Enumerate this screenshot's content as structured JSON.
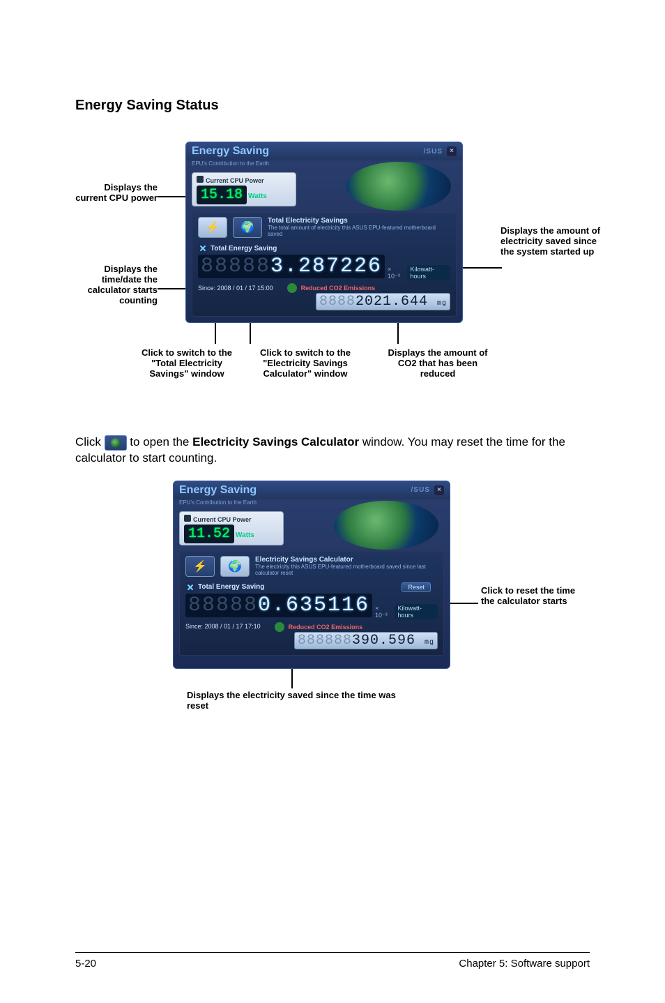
{
  "page": {
    "section_title": "Energy Saving Status",
    "footer_left": "5-20",
    "footer_right": "Chapter 5: Software support"
  },
  "paragraph": {
    "pre": "Click ",
    "mid": " to open the ",
    "bold": "Electricity Savings Calculator",
    "post": " window. You may reset the time for the calculator to start counting."
  },
  "panel1": {
    "title": "Energy Saving",
    "subline": "EPU's Contribution to the Earth",
    "logo": "/SUS",
    "cpu_label": "Current CPU Power",
    "cpu_value": "15.18",
    "cpu_unit": "Watts",
    "inner_title": "Total Electricity Savings",
    "inner_sub": "The total amount of electricity this ASUS EPU-featured motherboard saved",
    "section_label": "Total Energy Saving",
    "kw_dim": "88888",
    "kw_value": "3.287226",
    "kw_exp": "× 10⁻³",
    "kw_unit": "Kilowatt-hours",
    "since_label": "Since: 2008 / 01 / 17 15:00",
    "reduced_label": "Reduced CO2 Emissions",
    "co2_dim": "8888",
    "co2_value": "2021.644",
    "co2_unit": "mg"
  },
  "panel2": {
    "title": "Energy Saving",
    "subline": "EPU's Contribution to the Earth",
    "logo": "/SUS",
    "cpu_label": "Current CPU Power",
    "cpu_value": "11.52",
    "cpu_unit": "Watts",
    "inner_title": "Electricity Savings Calculator",
    "inner_sub": "The electricity this ASUS EPU-featured motherboard saved since last calculator reset",
    "section_label": "Total Energy Saving",
    "reset": "Reset",
    "kw_dim": "88888",
    "kw_value": "0.635116",
    "kw_exp": "× 10⁻³",
    "kw_unit": "Kilowatt-hours",
    "since_label": "Since: 2008 / 01 / 17 17:10",
    "reduced_label": "Reduced CO2 Emissions",
    "co2_dim": "888888",
    "co2_value": "390.596",
    "co2_unit": "mg"
  },
  "callouts1": {
    "left1": "Displays the current CPU power",
    "left2": "Displays the time/date the calculator starts counting",
    "right1": "Displays the amount of electricity saved since the system started up",
    "b1": "Click to switch to the \"Total Electricity Savings\" window",
    "b2": "Click to switch to the \"Electricity Savings Calculator\" window",
    "b3": "Displays the amount of CO2 that has been reduced"
  },
  "callouts2": {
    "right": "Click to reset the time the calculator starts",
    "bottom": "Displays the electricity saved since the time was reset"
  }
}
